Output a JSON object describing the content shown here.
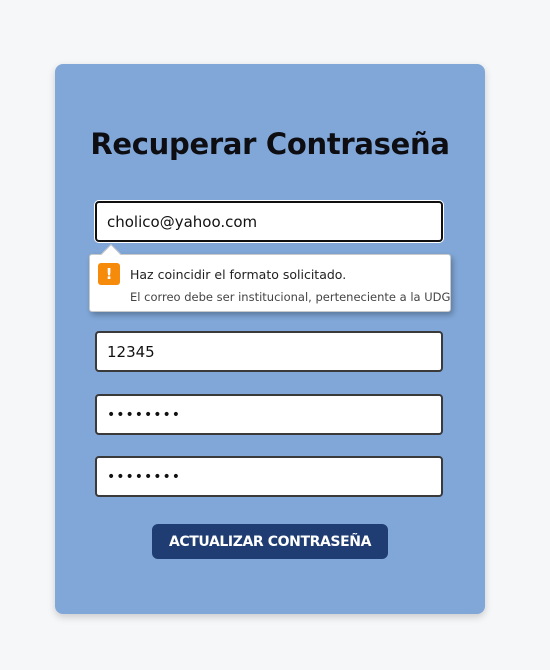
{
  "form": {
    "title": "Recuperar Contraseña",
    "email_value": "cholico@yahoo.com",
    "code_value": "12345",
    "password_value": "••••••••",
    "confirm_password_value": "••••••••",
    "submit_label": "ACTUALIZAR CONTRASEÑA"
  },
  "validation_tooltip": {
    "icon": "warning-icon",
    "icon_glyph": "!",
    "message": "Haz coincidir el formato solicitado.",
    "detail": "El correo debe ser institucional, perteneciente a la UDG"
  },
  "colors": {
    "page_background": "#f6f7f9",
    "card_background": "#80a7d8",
    "button_background": "#1f3d72",
    "warning_icon": "#f68a0a"
  }
}
